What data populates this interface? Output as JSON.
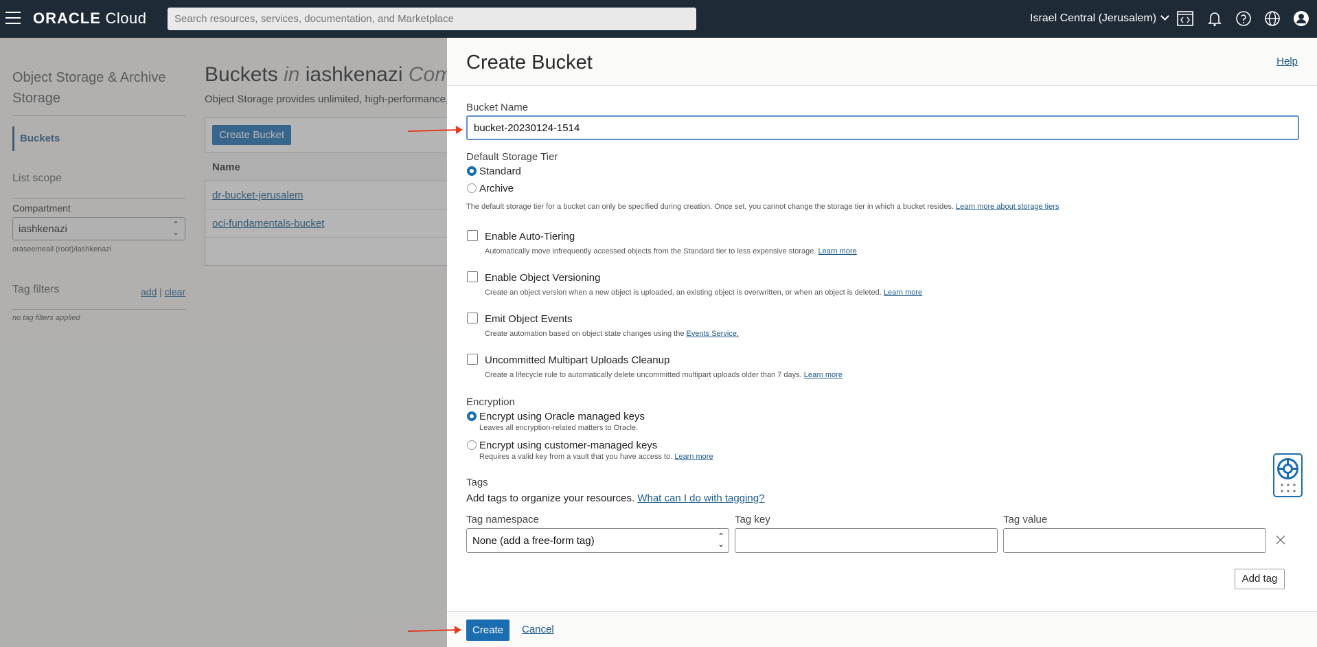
{
  "topbar": {
    "brand": "ORACLE",
    "brand_suffix": "Cloud",
    "search_placeholder": "Search resources, services, documentation, and Marketplace",
    "region": "Israel Central (Jerusalem)",
    "icons": [
      "code-editor-icon",
      "bell-icon",
      "help-icon",
      "globe-icon",
      "user-icon"
    ]
  },
  "sidebar": {
    "title": "Object Storage & Archive Storage",
    "active_item": "Buckets",
    "list_scope": "List scope",
    "compartment_label": "Compartment",
    "compartment_value": "iashkenazi",
    "compartment_path": "oraseemeail (root)/iashkenazi",
    "tag_filters_label": "Tag filters",
    "add": "add",
    "clear": "clear",
    "tag_filters_sep": "|",
    "no_tags": "no tag filters applied"
  },
  "main": {
    "heading_prefix": "Buckets",
    "heading_in": "in",
    "heading_compartment": "iashkenazi",
    "heading_suffix": "Comp",
    "subtitle": "Object Storage provides unlimited, high-performance, du",
    "create_bucket_button": "Create Bucket",
    "column_name": "Name",
    "buckets": [
      "dr-bucket-jerusalem",
      "oci-fundamentals-bucket"
    ]
  },
  "drawer": {
    "title": "Create Bucket",
    "help": "Help",
    "bucket_name_label": "Bucket Name",
    "bucket_name_value": "bucket-20230124-1514",
    "storage_tier_label": "Default Storage Tier",
    "tier_standard": "Standard",
    "tier_archive": "Archive",
    "tier_note": "The default storage tier for a bucket can only be specified during creation. Once set, you cannot change the storage tier in which a bucket resides.",
    "tier_note_link": "Learn more about storage tiers",
    "options": [
      {
        "label": "Enable Auto-Tiering",
        "desc": "Automatically move infrequently accessed objects from the Standard tier to less expensive storage.",
        "link": "Learn more"
      },
      {
        "label": "Enable Object Versioning",
        "desc": "Create an object version when a new object is uploaded, an existing object is overwritten, or when an object is deleted.",
        "link": "Learn more"
      },
      {
        "label": "Emit Object Events",
        "desc": "Create automation based on object state changes using the",
        "link": "Events Service."
      },
      {
        "label": "Uncommitted Multipart Uploads Cleanup",
        "desc": "Create a lifecycle rule to automatically delete uncommitted multipart uploads older than 7 days.",
        "link": "Learn more"
      }
    ],
    "encryption_label": "Encryption",
    "enc_oracle": "Encrypt using Oracle managed keys",
    "enc_oracle_desc": "Leaves all encryption-related matters to Oracle.",
    "enc_customer": "Encrypt using customer-managed keys",
    "enc_customer_desc": "Requires a valid key from a vault that you have access to.",
    "enc_customer_link": "Learn more",
    "tags_label": "Tags",
    "tags_desc": "Add tags to organize your resources.",
    "tags_link": "What can I do with tagging?",
    "tag_namespace_label": "Tag namespace",
    "tag_key_label": "Tag key",
    "tag_value_label": "Tag value",
    "tag_namespace_value": "None (add a free-form tag)",
    "add_tag": "Add tag",
    "create": "Create",
    "cancel": "Cancel"
  },
  "colors": {
    "topbar": "#1e2a36",
    "primary": "#1b6db2",
    "annotation_arrow": "#e53a1e"
  }
}
